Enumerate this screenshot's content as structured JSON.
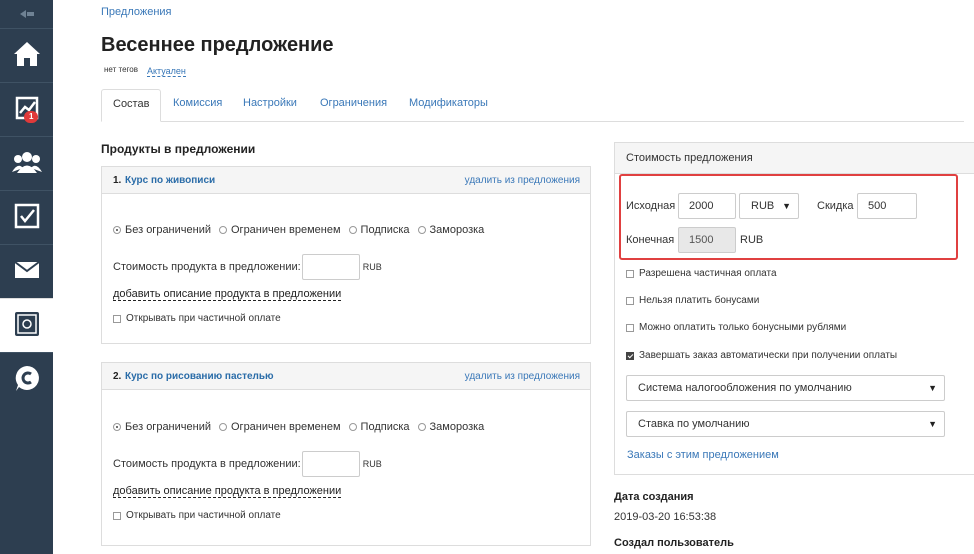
{
  "sidebar": {
    "items": [
      {
        "icon": "home-icon"
      },
      {
        "icon": "chart-icon",
        "badge": "1"
      },
      {
        "icon": "users-icon"
      },
      {
        "icon": "checkbox-icon"
      },
      {
        "icon": "mail-icon"
      },
      {
        "icon": "safe-icon"
      },
      {
        "icon": "chat-icon"
      }
    ]
  },
  "breadcrumb": "Предложения",
  "page_title": "Весеннее предложение",
  "tags": "нет тегов",
  "status": "Актуален",
  "tabs": [
    {
      "label": "Состав",
      "active": true
    },
    {
      "label": "Комиссия"
    },
    {
      "label": "Настройки"
    },
    {
      "label": "Ограничения"
    },
    {
      "label": "Модификаторы"
    }
  ],
  "products_title": "Продукты в предложении",
  "products": [
    {
      "num": "1.",
      "name": "Курс по живописи",
      "remove_label": "удалить из предложения",
      "options": [
        "Без ограничений",
        "Ограничен временем",
        "Подписка",
        "Заморозка"
      ],
      "selected_option": "Без ограничений",
      "price_label": "Стоимость продукта в предложении:",
      "price_value": "",
      "currency": "RUB",
      "desc_link": "добавить описание продукта в предложении",
      "partial_label": "Открывать при частичной оплате"
    },
    {
      "num": "2.",
      "name": "Курс по рисованию пастелью",
      "remove_label": "удалить из предложения",
      "options": [
        "Без ограничений",
        "Ограничен временем",
        "Подписка",
        "Заморозка"
      ],
      "selected_option": "Без ограничений",
      "price_label": "Стоимость продукта в предложении:",
      "price_value": "",
      "currency": "RUB",
      "desc_link": "добавить описание продукта в предложении",
      "partial_label": "Открывать при частичной оплате"
    }
  ],
  "cost_panel": {
    "title": "Стоимость предложения",
    "original_label": "Исходная",
    "original_value": "2000",
    "currency": "RUB",
    "discount_label": "Скидка",
    "discount_value": "500",
    "final_label": "Конечная",
    "final_value": "1500",
    "final_currency": "RUB",
    "checkboxes": [
      {
        "label": "Разрешена частичная оплата",
        "checked": false
      },
      {
        "label": "Нельзя платить бонусами",
        "checked": false
      },
      {
        "label": "Можно оплатить только бонусными рублями",
        "checked": false
      },
      {
        "label": "Завершать заказ автоматически при получении оплаты",
        "checked": true
      }
    ],
    "tax_select": "Система налогообложения по умолчанию",
    "rate_select": "Ставка по умолчанию",
    "orders_link": "Заказы с этим предложением",
    "highlight_color": "#e04040"
  },
  "meta": {
    "created_label": "Дата создания",
    "created_value": "2019-03-20 16:53:38",
    "creator_label": "Создал пользователь"
  }
}
